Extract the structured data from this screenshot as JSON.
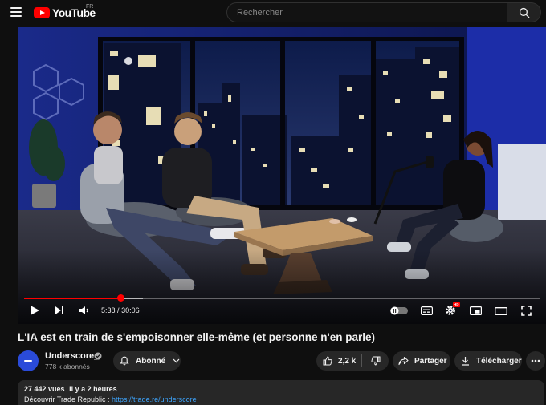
{
  "header": {
    "logo_text": "YouTube",
    "region": "FR",
    "search_placeholder": "Rechercher"
  },
  "player": {
    "current_time": "5:38",
    "duration": "30:06",
    "progress_fraction": 0.187,
    "buffered_fraction": 0.23,
    "settings_badge": "HD"
  },
  "video": {
    "title": "L'IA est en train de s'empoisonner elle-même (et personne n'en parle)"
  },
  "channel": {
    "name": "Underscore_",
    "subscribers": "778 k abonnés"
  },
  "actions": {
    "subscribe_label": "Abonné",
    "likes": "2,2 k",
    "share_label": "Partager",
    "download_label": "Télécharger"
  },
  "description": {
    "views": "27 442 vues",
    "time_ago": "il y a 2 heures",
    "promo_text": "Découvrir Trade Republic : ",
    "promo_link": "https://trade.re/underscore"
  },
  "colors": {
    "brand_red": "#ff0000",
    "accent_link": "#3ea6ff",
    "avatar_blue": "#2a4bd9",
    "background": "#0f0f0f"
  }
}
